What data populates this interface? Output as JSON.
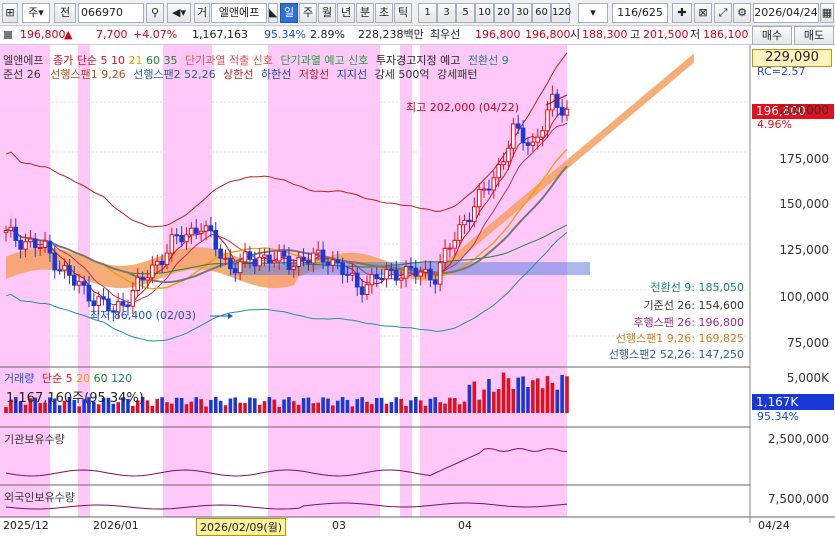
{
  "toolbar": {
    "code": "066970",
    "name": "엘앤에프",
    "market": "주",
    "jeon": "전",
    "geo": "거",
    "periods": [
      "일",
      "주",
      "월",
      "년",
      "분",
      "초",
      "틱"
    ],
    "selected_period": "일",
    "nums": [
      "1",
      "3",
      "5",
      "10",
      "20",
      "30",
      "60",
      "120"
    ],
    "count": "116/625",
    "date": "2026/04/24"
  },
  "quote": {
    "price": "196,800",
    "arrow": "▲",
    "change": "7,700",
    "pct": "+4.07%",
    "volume": "1,167,163",
    "vol_ratio": "95.34%",
    "turnover": "2.89%",
    "amount": "228,238백만",
    "sell_label": "최우선",
    "best_sell": "196,800",
    "best_buy": "196,800",
    "open_label": "시",
    "open": "188,300",
    "high_label": "고",
    "high": "201,500",
    "low_label": "저",
    "low": "186,100"
  },
  "side": {
    "price_box": "229,090",
    "buy": "매수",
    "sell": "매도",
    "cur_price": "196,800",
    "cur_pct": "4.96%",
    "rc": "RC=2.57",
    "vol_box": "1,167K",
    "vol_pct": "95.34%"
  },
  "legend": {
    "row1": [
      "엘앤에프",
      "종가 단순 5",
      "10",
      "21",
      "60",
      "35",
      "단기과열 적출 신호",
      "단기과열 예고 신호",
      "투자경고지정 예고",
      "전환선 9"
    ],
    "row2": [
      "준선 26",
      "선행스팬1 9,26",
      "선행스팬2 52,26",
      "상한선",
      "하한선",
      "저항선",
      "지지선",
      "강세 500억",
      "강세패턴"
    ]
  },
  "annot": {
    "high": "최고 202,000 (04/22)",
    "low": "최저 86,400 (02/03)"
  },
  "ichimoku_labels": [
    "전환선 9: 185,050",
    "기준선 26: 154,600",
    "후행스팬 26: 196,800",
    "선행스팬1 9,26: 169,825",
    "선행스팬2 52,26: 147,250"
  ],
  "price_axis": [
    "200,000",
    "175,000",
    "150,000",
    "125,000",
    "100,000",
    "75,000"
  ],
  "volume": {
    "title": "거래량",
    "ma": "단순 5",
    "ma_vals": [
      "20",
      "60",
      "120"
    ],
    "value": "1,167,160주(95.34%)",
    "axis": "5,000K"
  },
  "inst": {
    "title": "기관보유수량",
    "axis": "2,500,000"
  },
  "foreign": {
    "title": "외국인보유수량",
    "axis": "7,500,000"
  },
  "dates": [
    "2025/12",
    "2026/01",
    "2026/02/09(월)",
    "03",
    "04",
    "04/24"
  ],
  "colors": {
    "up": "#e0101e",
    "down": "#1838d8",
    "shade": "#ffc8f8",
    "cloud": "#f5a060"
  }
}
